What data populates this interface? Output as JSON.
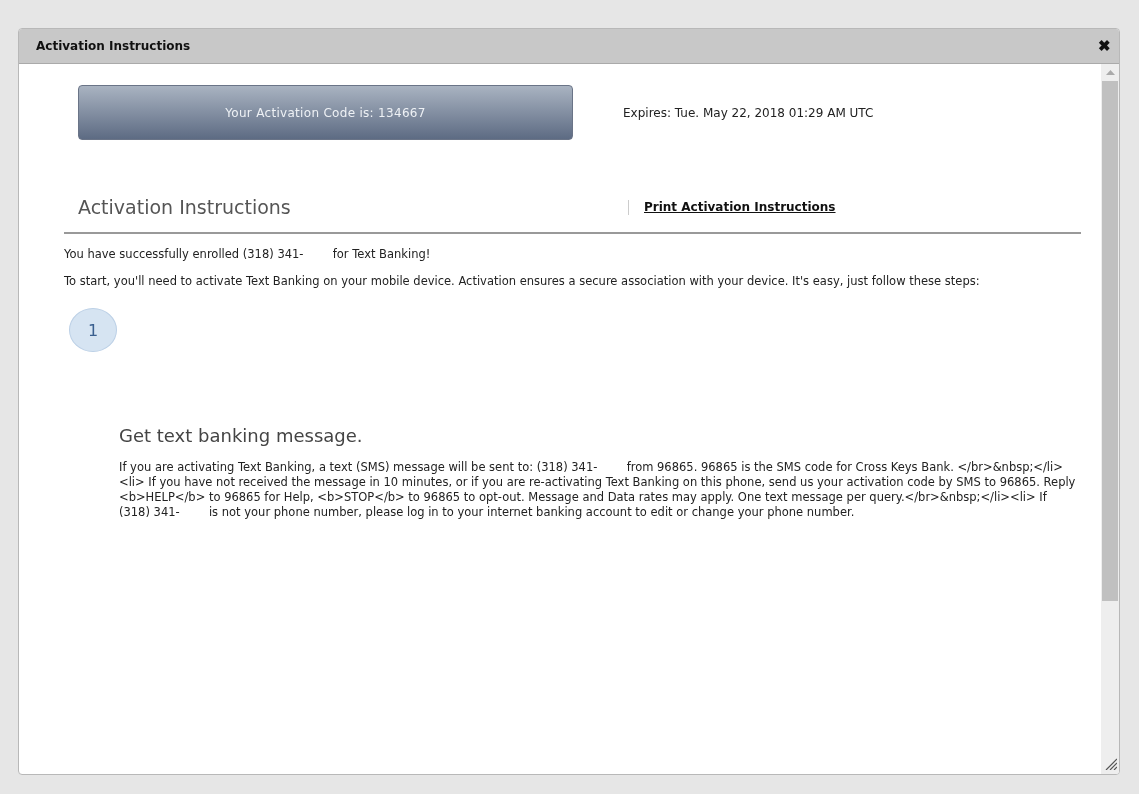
{
  "dialog": {
    "title": "Activation Instructions",
    "close": "✖"
  },
  "code_banner": {
    "label": "Your Activation Code is: 134667",
    "expires": "Expires: Tue. May 22, 2018 01:29 AM UTC"
  },
  "section": {
    "heading": "Activation Instructions",
    "print_link": "Print Activation Instructions"
  },
  "intro": [
    "You have successfully enrolled (318) 341-        for Text Banking!",
    "To start, you'll need to activate Text Banking on your mobile device. Activation ensures a secure association with your device. It's easy, just follow these steps:"
  ],
  "steps": [
    {
      "number": "1",
      "title": "Get text banking message.",
      "body": "If you are activating Text Banking, a text (SMS) message will be sent to: (318) 341-        from 96865. 96865 is the SMS code for Cross Keys Bank. </br>&nbsp;</li><li> If you have not received the message in 10 minutes, or if you are re-activating Text Banking on this phone, send us your activation code by SMS to 96865. Reply <b>HELP</b> to 96865 for Help, <b>STOP</b> to 96865 to opt-out. Message and Data rates may apply. One text message per query.</br>&nbsp;</li><li> If (318) 341-        is not your phone number, please log in to your internet banking account to edit or change your phone number."
    }
  ]
}
